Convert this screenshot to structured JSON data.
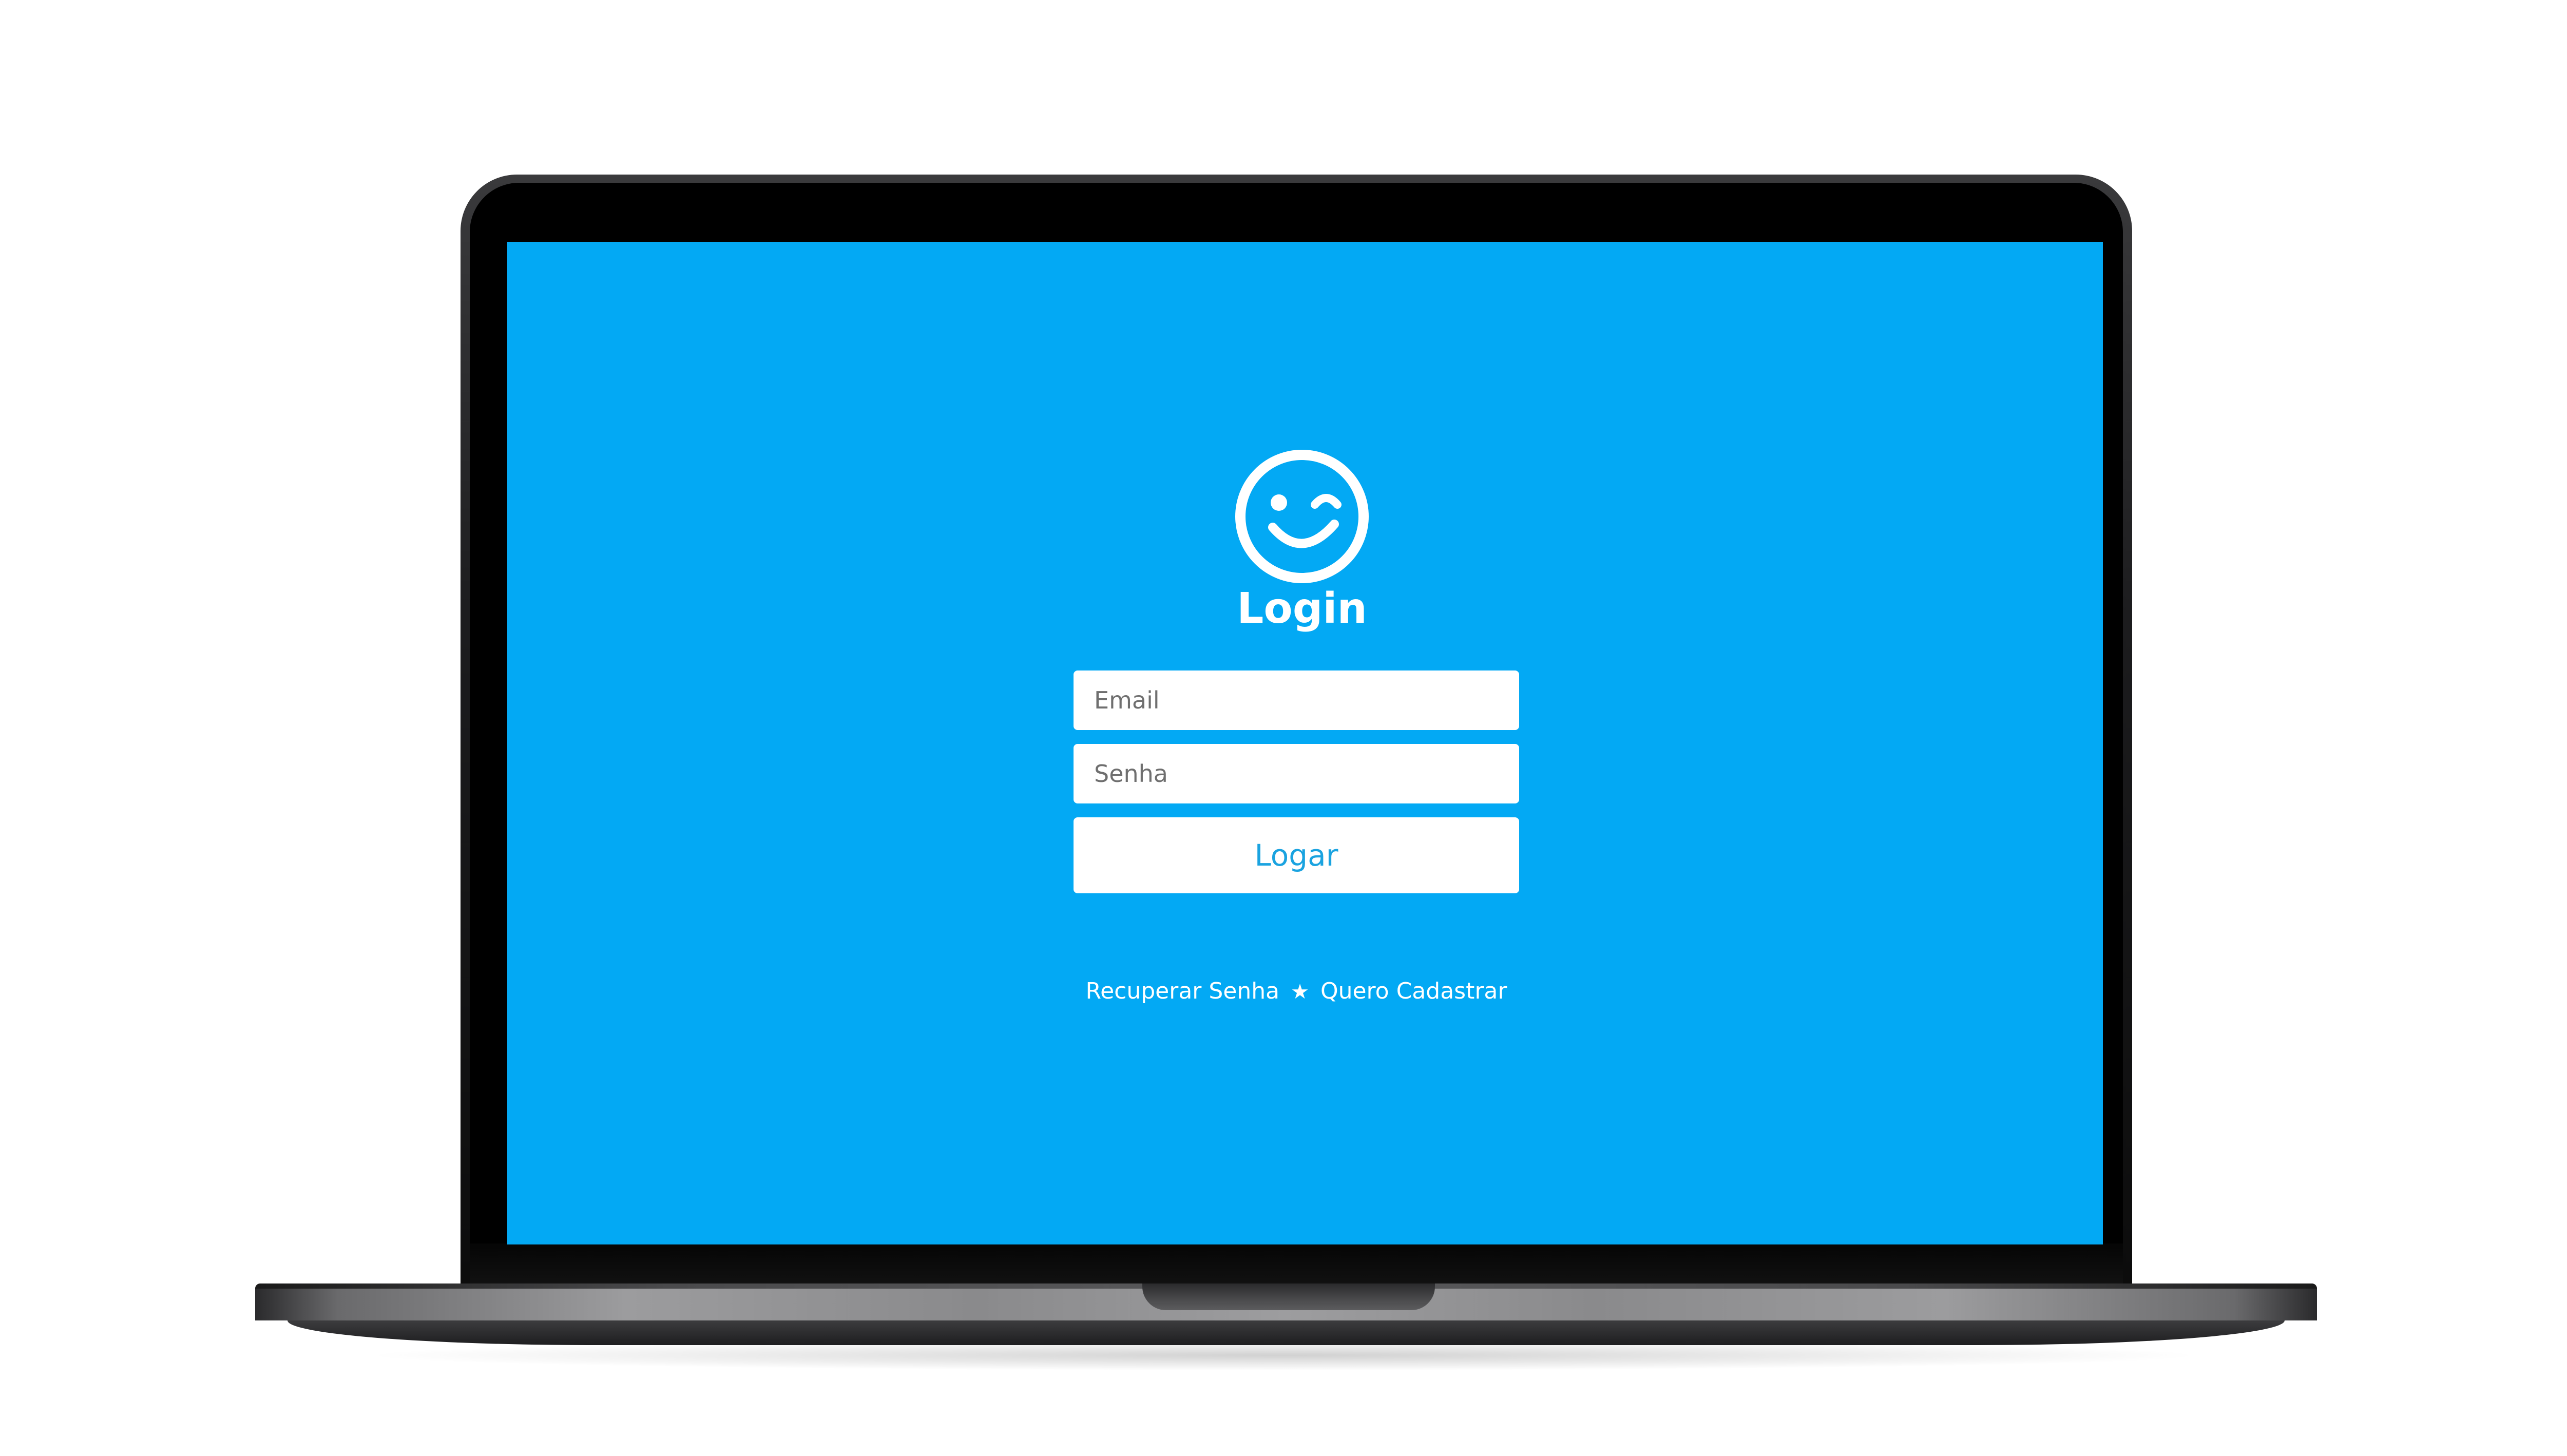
{
  "colors": {
    "screen_background": "#03a9f4",
    "text_on_blue": "#ffffff",
    "button_text": "#1aa3e0"
  },
  "header": {
    "logo_icon": "winking-smiley-icon",
    "title": "Login"
  },
  "form": {
    "email_placeholder": "Email",
    "email_value": "",
    "password_placeholder": "Senha",
    "password_value": "",
    "submit_label": "Logar"
  },
  "links": {
    "recover_password": "Recuperar Senha",
    "separator": "★",
    "register": "Quero Cadastrar"
  }
}
